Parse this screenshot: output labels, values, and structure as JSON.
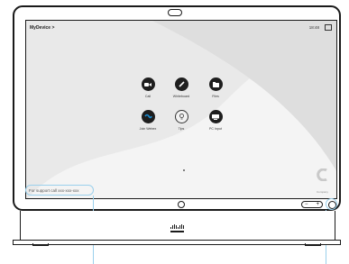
{
  "header": {
    "device_name": "MyDevice",
    "device_chevron": ">",
    "time": "18:48"
  },
  "home_tiles": [
    {
      "label": "Call",
      "icon": "video-camera-icon"
    },
    {
      "label": "Whiteboard",
      "icon": "pencil-icon"
    },
    {
      "label": "Files",
      "icon": "folder-icon"
    },
    {
      "label": "Join Webex",
      "icon": "webex-icon"
    },
    {
      "label": "Tips",
      "icon": "lightbulb-icon"
    },
    {
      "label": "PC Input",
      "icon": "monitor-icon"
    }
  ],
  "footer": {
    "support_text": "For support call xxx-xxx-xxx"
  },
  "brand": {
    "screen_logo_caption": "Company",
    "hardware_logo": "cisco-logo"
  },
  "colors": {
    "highlight": "#9ad0ec",
    "tile_fill": "#1e1e1e",
    "webex_accent": "#1a8fd6"
  },
  "hardware": {
    "volume_down": "−",
    "volume_up": "+"
  }
}
